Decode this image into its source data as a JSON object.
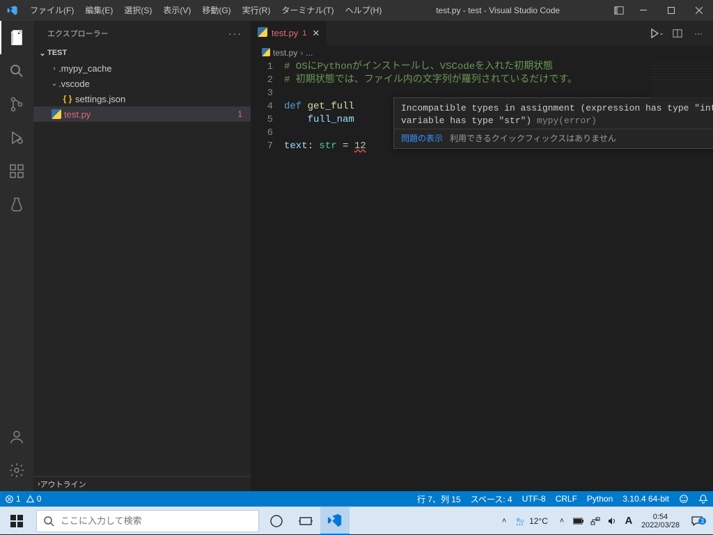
{
  "titlebar": {
    "title": "test.py - test - Visual Studio Code"
  },
  "menu": [
    "ファイル(F)",
    "編集(E)",
    "選択(S)",
    "表示(V)",
    "移動(G)",
    "実行(R)",
    "ターミナル(T)",
    "ヘルプ(H)"
  ],
  "sidebar": {
    "title": "エクスプローラー",
    "project": "TEST",
    "items": [
      {
        "name": ".mypy_cache",
        "type": "folder",
        "expanded": false,
        "indent": 1
      },
      {
        "name": ".vscode",
        "type": "folder",
        "expanded": true,
        "indent": 1
      },
      {
        "name": "settings.json",
        "type": "json",
        "indent": 2
      },
      {
        "name": "test.py",
        "type": "py",
        "indent": 1,
        "selected": true,
        "problems": "1"
      }
    ],
    "outline": "アウトライン"
  },
  "tab": {
    "name": "test.py",
    "dirty": "1"
  },
  "breadcrumb": {
    "file": "test.py",
    "more": "..."
  },
  "gutter": [
    "1",
    "2",
    "3",
    "4",
    "5",
    "6",
    "7"
  ],
  "code": {
    "c1": "# OSにPythonがインストールし、VSCodeを入れた初期状態",
    "c2": "# 初期状態では、ファイル内の文字列が羅列されているだけです。",
    "l4_def": "def ",
    "l4_fn": "get_full",
    "l5_var": "full_nam",
    "l7_var": "text",
    "l7_colon": ": ",
    "l7_type": "str",
    "l7_eq": " = ",
    "l7_num": "12"
  },
  "hover": {
    "message": "Incompatible types in assignment (expression has type \"int\", variable has type \"str\")",
    "source": " mypy(error)",
    "action_link": "問題の表示",
    "action_na": "利用できるクイックフィックスはありません"
  },
  "statusbar": {
    "errors": "1",
    "warnings": "0",
    "cursor": "行 7、列 15",
    "spaces": "スペース: 4",
    "encoding": "UTF-8",
    "eol": "CRLF",
    "lang": "Python",
    "interpreter": "3.10.4 64-bit"
  },
  "taskbar": {
    "search_placeholder": "ここに入力して検索",
    "temp": "12°C",
    "time": "0:54",
    "date": "2022/03/28",
    "notif_count": "3"
  }
}
